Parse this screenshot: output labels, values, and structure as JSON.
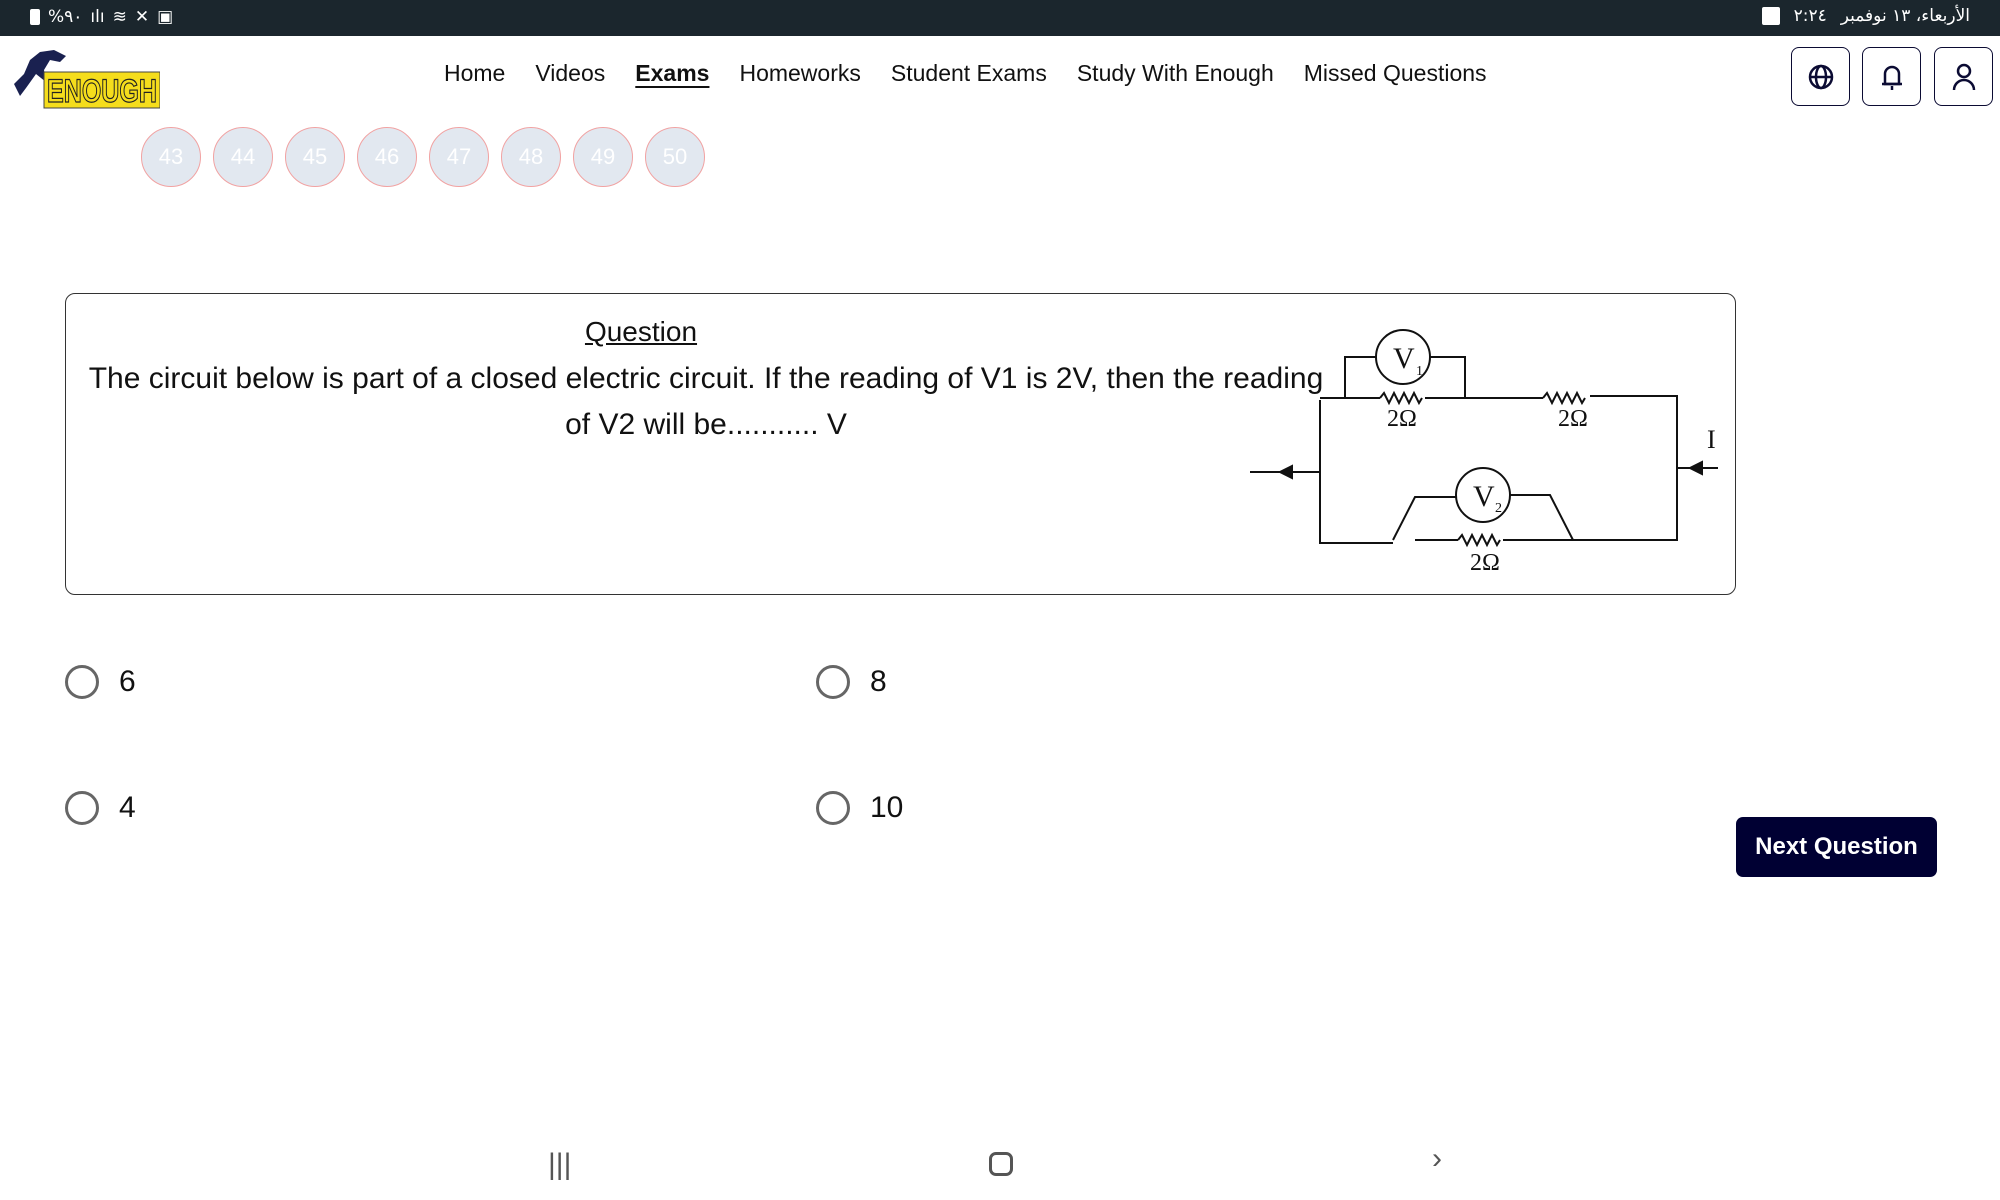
{
  "status_bar": {
    "battery": "%٩٠",
    "datetime": "الأربعاء، ١٣ نوفمبر",
    "time": "٢:٢٤",
    "icons": [
      "battery-icon",
      "signal-icon",
      "wifi-icon",
      "mute-icon",
      "recycle-icon",
      "gallery-icon"
    ]
  },
  "header": {
    "logo_text": "ENOUGH",
    "nav": [
      "Home",
      "Videos",
      "Exams",
      "Homeworks",
      "Student Exams",
      "Study With Enough",
      "Missed Questions"
    ],
    "active": "Exams",
    "buttons": [
      "globe-icon",
      "bell-icon",
      "user-icon"
    ]
  },
  "question_nav": {
    "visible_numbers": [
      "43",
      "44",
      "45",
      "46",
      "47",
      "48",
      "49",
      "50"
    ]
  },
  "question": {
    "title": "Question",
    "text": "The circuit below is part of a closed electric circuit. If the reading of V1 is 2V, then the reading of V2 will be........... V",
    "circuit": {
      "v1": "V",
      "v1_sub": "1",
      "v2": "V",
      "v2_sub": "2",
      "r1": "2Ω",
      "r2": "2Ω",
      "r3": "2Ω",
      "current": "I"
    }
  },
  "options": [
    "6",
    "8",
    "4",
    "10"
  ],
  "next_button": "Next Question",
  "colors": {
    "accent": "#000033",
    "status_bar": "#1b262d",
    "bubble_fill": "#e2e8f0",
    "bubble_border": "#f1a2a2"
  }
}
